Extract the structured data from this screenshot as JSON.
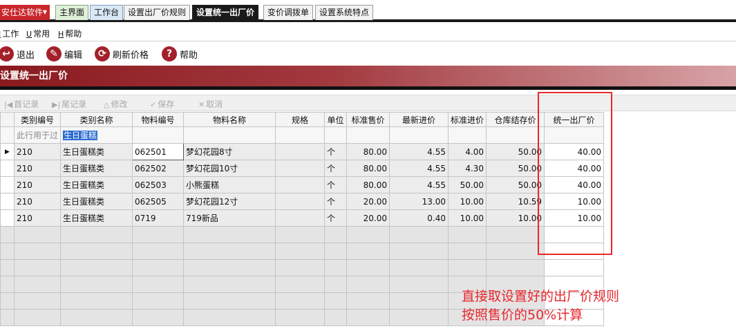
{
  "app": {
    "name": "安仕达软件"
  },
  "tabs": [
    {
      "label": "主界面",
      "style": "home"
    },
    {
      "label": "工作台",
      "style": "work"
    },
    {
      "label": "设置出厂价规则",
      "style": "normal"
    },
    {
      "label": "设置统一出厂价",
      "style": "active"
    },
    {
      "label": "变价调拨单",
      "style": "normal"
    },
    {
      "label": "设置系统特点",
      "style": "normal"
    }
  ],
  "menu": [
    {
      "key": "I",
      "label": "工作"
    },
    {
      "key": "U",
      "label": "常用"
    },
    {
      "key": "H",
      "label": "帮助"
    }
  ],
  "toolbar": [
    {
      "label": "退出",
      "icon": "exit-icon"
    },
    {
      "label": "编辑",
      "icon": "edit-icon"
    },
    {
      "label": "刷新价格",
      "icon": "refresh-icon"
    },
    {
      "label": "帮助",
      "icon": "help-icon"
    }
  ],
  "banner": {
    "title": "设置统一出厂价"
  },
  "nav": [
    {
      "label": "首记录",
      "icon": "first-record-icon"
    },
    {
      "label": "尾记录",
      "icon": "last-record-icon"
    },
    {
      "label": "修改",
      "icon": "modify-icon"
    },
    {
      "label": "保存",
      "icon": "save-icon"
    },
    {
      "label": "取消",
      "icon": "cancel-icon"
    }
  ],
  "grid": {
    "columns": [
      "类别编号",
      "类别名称",
      "物料编号",
      "物料名称",
      "规格",
      "单位",
      "标准售价",
      "最新进价",
      "标准进价",
      "仓库结存价",
      "统一出厂价"
    ],
    "filter_hint": "此行用于过",
    "filter_value": "生日蛋糕",
    "rows": [
      [
        "210",
        "生日蛋糕类",
        "062501",
        "梦幻花园8寸",
        "",
        "个",
        "80.00",
        "4.55",
        "4.00",
        "50.00",
        "40.00"
      ],
      [
        "210",
        "生日蛋糕类",
        "062502",
        "梦幻花园10寸",
        "",
        "个",
        "80.00",
        "4.55",
        "4.30",
        "50.00",
        "40.00"
      ],
      [
        "210",
        "生日蛋糕类",
        "062503",
        "小熊蛋糕",
        "",
        "个",
        "80.00",
        "4.55",
        "50.00",
        "50.00",
        "40.00"
      ],
      [
        "210",
        "生日蛋糕类",
        "062505",
        "梦幻花园12寸",
        "",
        "个",
        "20.00",
        "13.00",
        "10.00",
        "10.59",
        "10.00"
      ],
      [
        "210",
        "生日蛋糕类",
        "0719",
        "719新品",
        "",
        "个",
        "20.00",
        "0.40",
        "10.00",
        "10.00",
        "10.00"
      ]
    ]
  },
  "annotation": {
    "line1": "直接取设置好的出厂价规则",
    "line2": "按照售价的50%计算"
  }
}
